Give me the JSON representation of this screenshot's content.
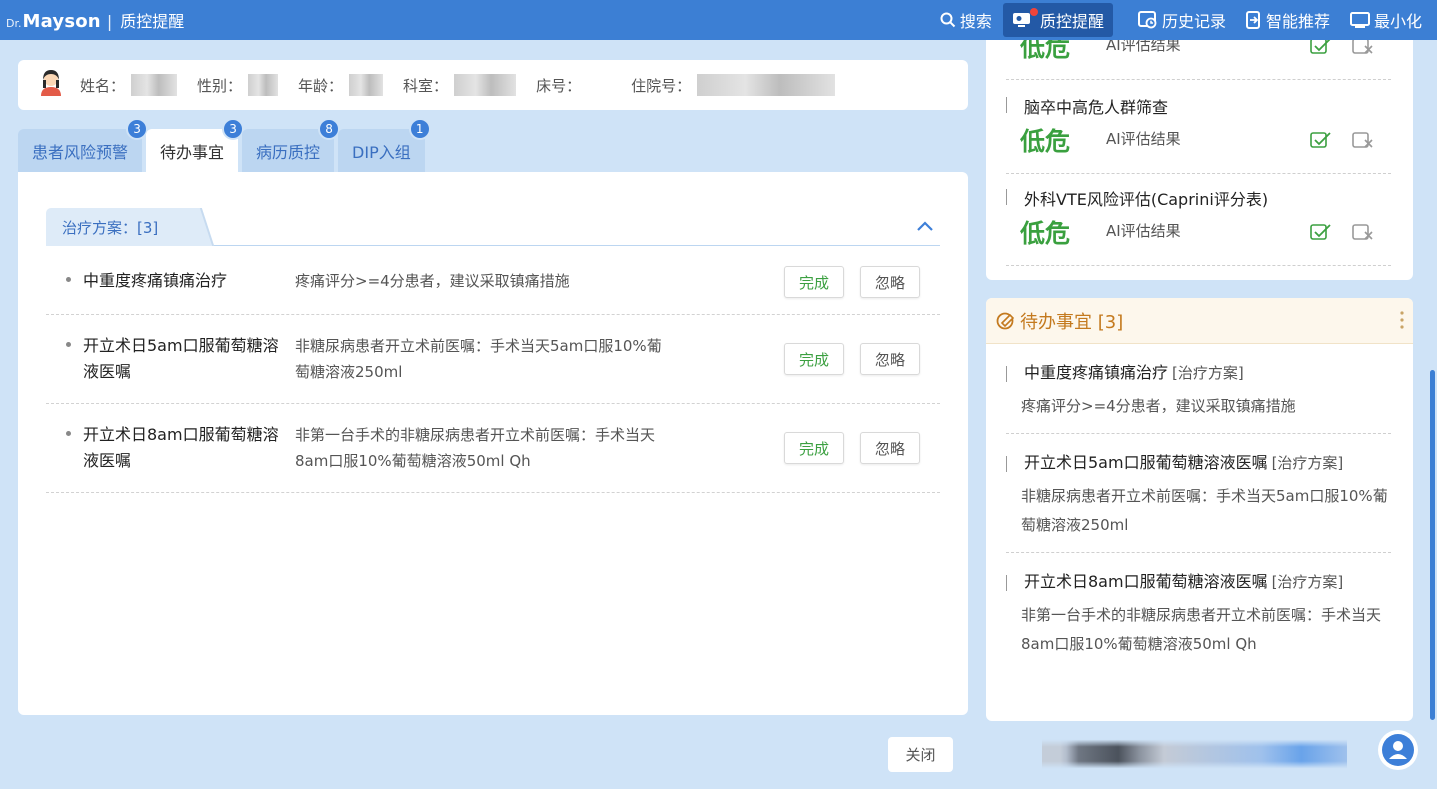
{
  "topbar": {
    "brand_prefix": "Dr.",
    "brand_name": "Mayson",
    "brand_separator": "|",
    "module": "质控提醒",
    "actions": {
      "search": "搜索",
      "qc": "质控提醒",
      "history": "历史记录",
      "recommend": "智能推荐",
      "minimize": "最小化"
    }
  },
  "patient": {
    "name_label": "姓名：",
    "gender_label": "性别：",
    "age_label": "年龄：",
    "dept_label": "科室：",
    "bed_label": "床号：",
    "admission_label": "住院号："
  },
  "tabs": [
    {
      "label": "患者风险预警",
      "badge": "3"
    },
    {
      "label": "待办事宜",
      "badge": "3"
    },
    {
      "label": "病历质控",
      "badge": "8"
    },
    {
      "label": "DIP入组",
      "badge": "1"
    }
  ],
  "section": {
    "title": "治疗方案：[3]"
  },
  "todos": [
    {
      "title": "中重度疼痛镇痛治疗",
      "desc": "疼痛评分>=4分患者，建议采取镇痛措施"
    },
    {
      "title": "开立术日5am口服葡萄糖溶液医嘱",
      "desc": "非糖尿病患者开立术前医嘱：手术当天5am口服10%葡萄糖溶液250ml"
    },
    {
      "title": "开立术日8am口服葡萄糖溶液医嘱",
      "desc": "非第一台手术的非糖尿病患者开立术前医嘱：手术当天8am口服10%葡萄糖溶液50ml Qh"
    }
  ],
  "buttons": {
    "done": "完成",
    "ignore": "忽略",
    "close": "关闭"
  },
  "risk": [
    {
      "name": "",
      "level": "低危",
      "ai": "AI评估结果"
    },
    {
      "name": "脑卒中高危人群筛查",
      "level": "低危",
      "ai": "AI评估结果"
    },
    {
      "name": "外科VTE风险评估(Caprini评分表)",
      "level": "低危",
      "ai": "AI评估结果"
    }
  ],
  "todo_card": {
    "title": "待办事宜 [3]",
    "tag": "[治疗方案]",
    "items": [
      {
        "title": "中重度疼痛镇痛治疗",
        "desc": "疼痛评分>=4分患者，建议采取镇痛措施"
      },
      {
        "title": "开立术日5am口服葡萄糖溶液医嘱",
        "desc": "非糖尿病患者开立术前医嘱：手术当天5am口服10%葡萄糖溶液250ml"
      },
      {
        "title": "开立术日8am口服葡萄糖溶液医嘱",
        "desc": "非第一台手术的非糖尿病患者开立术前医嘱：手术当天8am口服10%葡萄糖溶液50ml Qh"
      }
    ]
  },
  "colors": {
    "topbar": "#3c7fd4",
    "accent": "#3d7fd8",
    "success": "#3ca041",
    "warning": "#c47a1f",
    "background": "#cfe3f7"
  }
}
